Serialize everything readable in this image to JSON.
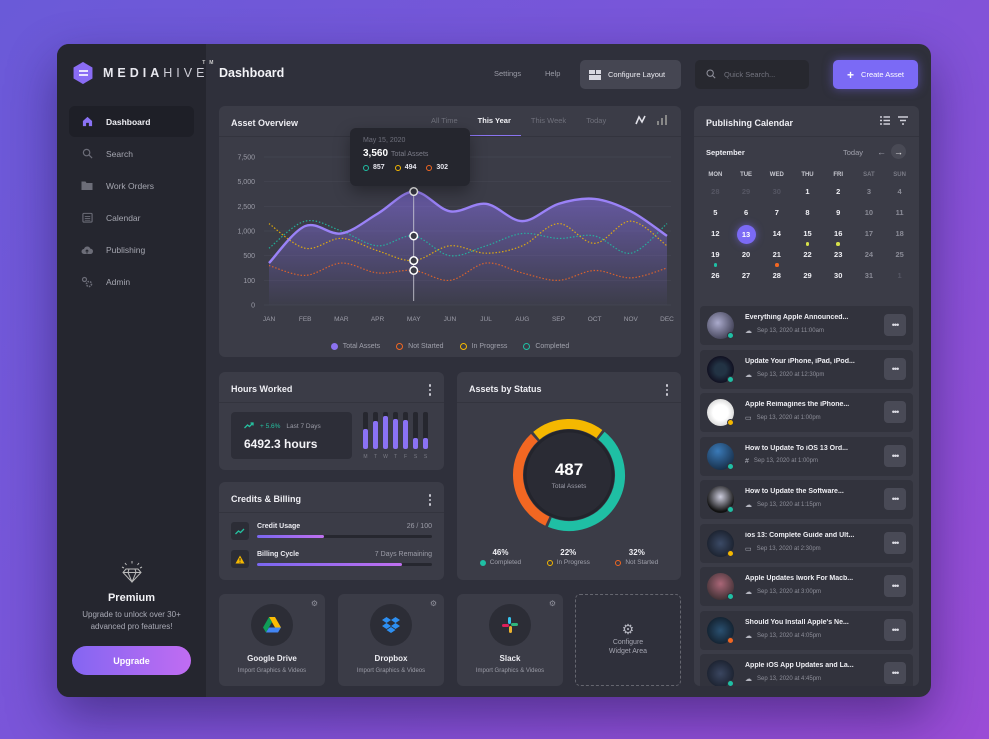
{
  "app": {
    "brand_bold": "MEDIA",
    "brand_thin": "HIVE",
    "trademark": "TM"
  },
  "colors": {
    "accent": "#7b6af5",
    "completed": "#1fbfa4",
    "in_progress": "#f5b800",
    "not_started": "#f26722",
    "total": "#8b72f0"
  },
  "sidebar": {
    "items": [
      {
        "label": "Dashboard",
        "icon": "home-icon",
        "active": true
      },
      {
        "label": "Search",
        "icon": "search-icon"
      },
      {
        "label": "Work Orders",
        "icon": "folder-icon"
      },
      {
        "label": "Calendar",
        "icon": "calendar-icon"
      },
      {
        "label": "Publishing",
        "icon": "cloud-upload-icon"
      },
      {
        "label": "Admin",
        "icon": "gears-icon"
      }
    ],
    "premium": {
      "title": "Premium",
      "desc_line1": "Upgrade to unlock over 30+",
      "desc_line2": "advanced pro features!",
      "button": "Upgrade"
    }
  },
  "header": {
    "title": "Dashboard",
    "settings": "Settings",
    "help": "Help",
    "configure_layout": "Configure Layout",
    "search_placeholder": "Quick Search...",
    "create_asset": "Create Asset"
  },
  "overview": {
    "title": "Asset Overview",
    "tabs": [
      "All Time",
      "This Year",
      "This Week",
      "Today"
    ],
    "active_tab": "This Year",
    "tooltip": {
      "date": "May 15, 2020",
      "total": "3,560",
      "total_label": "Total Assets",
      "completed": "857",
      "in_progress": "494",
      "not_started": "302"
    },
    "legend": [
      "Total Assets",
      "Not Started",
      "In Progress",
      "Completed"
    ]
  },
  "chart_data": {
    "type": "area",
    "title": "Asset Overview",
    "categories": [
      "JAN",
      "FEB",
      "MAR",
      "APR",
      "MAY",
      "JUN",
      "JUL",
      "AUG",
      "SEP",
      "OCT",
      "NOV",
      "DEC"
    ],
    "y_ticks": [
      "0",
      "100",
      "500",
      "1,000",
      "2,500",
      "5,000",
      "7,500"
    ],
    "y_tick_values": [
      0,
      100,
      500,
      1000,
      2500,
      5000,
      7500
    ],
    "scale_note": "non-linear axis; values given in tick index units",
    "series": [
      {
        "name": "Total Assets",
        "style": "area",
        "values": [
          1.7,
          3.2,
          2.9,
          3.7,
          4.6,
          3.8,
          4.1,
          3.4,
          4.1,
          4.3,
          3.8,
          2.8
        ]
      },
      {
        "name": "Completed",
        "style": "dotted",
        "values": [
          2.3,
          3.4,
          3.0,
          2.4,
          2.8,
          2.0,
          2.4,
          2.9,
          2.7,
          2.8,
          2.1,
          3.3
        ]
      },
      {
        "name": "In Progress",
        "style": "dotted",
        "values": [
          3.3,
          2.3,
          2.7,
          2.2,
          1.8,
          2.4,
          2.1,
          2.4,
          3.3,
          2.5,
          3.4,
          2.4
        ]
      },
      {
        "name": "Not Started",
        "style": "dotted",
        "values": [
          1.6,
          1.2,
          1.7,
          1.3,
          1.4,
          1.0,
          1.7,
          1.3,
          1.0,
          1.4,
          1.1,
          1.5
        ]
      }
    ],
    "highlight": {
      "category": "MAY",
      "date": "May 15, 2020"
    },
    "legend_position": "bottom",
    "grid": true
  },
  "hours": {
    "title": "Hours Worked",
    "trend": "+ 5.6%",
    "period": "Last 7 Days",
    "value": "6492.3 hours",
    "days": [
      "M",
      "T",
      "W",
      "T",
      "F",
      "S",
      "S"
    ],
    "levels": [
      0.55,
      0.75,
      0.9,
      0.8,
      0.78,
      0.3,
      0.3
    ]
  },
  "credits": {
    "title": "Credits & Billing",
    "rows": [
      {
        "label": "Credit Usage",
        "value": "26 / 100",
        "progress": 0.38
      },
      {
        "label": "Billing Cycle",
        "value": "7 Days Remaining",
        "progress": 0.83
      }
    ]
  },
  "status": {
    "title": "Assets by Status",
    "total": "487",
    "total_label": "Total Assets",
    "segments": [
      {
        "label": "Completed",
        "pct": "46%",
        "value": 46
      },
      {
        "label": "In Progress",
        "pct": "22%",
        "value": 22
      },
      {
        "label": "Not Started",
        "pct": "32%",
        "value": 32
      }
    ]
  },
  "integrations": [
    {
      "name": "Google Drive",
      "sub": "Import Graphics & Videos"
    },
    {
      "name": "Dropbox",
      "sub": "Import Graphics & Videos"
    },
    {
      "name": "Slack",
      "sub": "Import Graphics & Videos"
    }
  ],
  "configure_widget": {
    "line1": "Configure",
    "line2": "Widget Area"
  },
  "calendar": {
    "title": "Publishing Calendar",
    "month": "September",
    "today": "Today",
    "dow": [
      "MON",
      "TUE",
      "WED",
      "THU",
      "FRI",
      "SAT",
      "SUN"
    ],
    "weeks": [
      [
        "28",
        "29",
        "30",
        "1",
        "2",
        "3",
        "4"
      ],
      [
        "5",
        "6",
        "7",
        "8",
        "9",
        "10",
        "11"
      ],
      [
        "12",
        "13",
        "14",
        "15",
        "16",
        "17",
        "18"
      ],
      [
        "19",
        "20",
        "21",
        "22",
        "23",
        "24",
        "25"
      ],
      [
        "26",
        "27",
        "28",
        "29",
        "30",
        "31",
        "1"
      ]
    ],
    "selected": "13"
  },
  "posts": [
    {
      "title": "Everything Apple Announced...",
      "time": "Sep 13, 2020 at 11:00am",
      "status": "completed",
      "channel": "cloud"
    },
    {
      "title": "Update Your iPhone, iPad, iPod...",
      "time": "Sep 13, 2020 at 12:30pm",
      "status": "completed",
      "channel": "cloud"
    },
    {
      "title": "Apple Reimagines the iPhone...",
      "time": "Sep 13, 2020 at 1:00pm",
      "status": "in_progress",
      "channel": "laptop"
    },
    {
      "title": "How to Update To iOS 13 Ord...",
      "time": "Sep 13, 2020 at 1:00pm",
      "status": "completed",
      "channel": "hashtag"
    },
    {
      "title": "How to Update the Software...",
      "time": "Sep 13, 2020 at 1:15pm",
      "status": "completed",
      "channel": "cloud"
    },
    {
      "title": "ios 13: Complete Guide and Ult...",
      "time": "Sep 13, 2020 at 2:30pm",
      "status": "in_progress",
      "channel": "laptop"
    },
    {
      "title": "Apple Updates Iwork For Macb...",
      "time": "Sep 13, 2020 at 3:00pm",
      "status": "completed",
      "channel": "cloud"
    },
    {
      "title": "Should You Install Apple's Ne...",
      "time": "Sep 13, 2020 at 4:05pm",
      "status": "not_started",
      "channel": "cloud"
    },
    {
      "title": "Apple iOS App Updates and La...",
      "time": "Sep 13, 2020 at 4:45pm",
      "status": "completed",
      "channel": "cloud"
    }
  ]
}
